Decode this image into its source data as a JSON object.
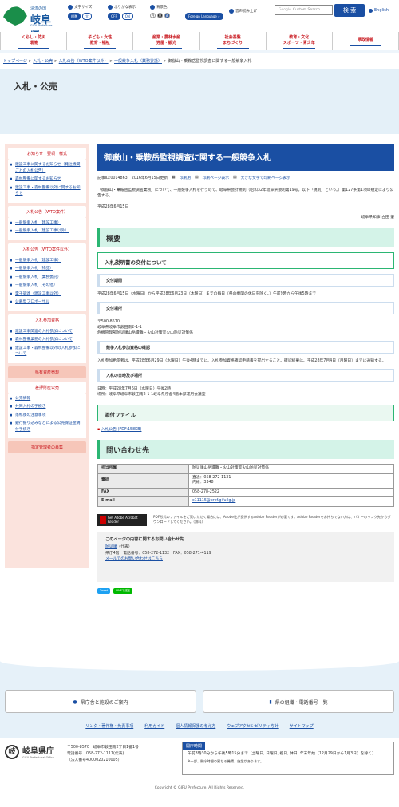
{
  "header": {
    "logo_tagline": "清流の国",
    "logo_name": "岐阜県",
    "logo_en": "GIFU Prefecture",
    "font_size_label": "文字サイズ",
    "font_standard": "標準",
    "font_large": "大",
    "ruby_label": "ふりがな表示",
    "ruby_off": "OFF",
    "ruby_on": "ON",
    "bg_label": "背景色",
    "bg_white": "白",
    "bg_black": "黒",
    "bg_blue": "青",
    "foreign_language": "Foreign Language »",
    "read_aloud": "音声読み上げ",
    "search_placeholder": "Custom Search",
    "search_brand": "Google",
    "search_button": "検 索",
    "english_link": "English"
  },
  "gnav": [
    {
      "l1": "くらし・防災",
      "l2": "環境"
    },
    {
      "l1": "子ども・女性",
      "l2": "教育・福祉"
    },
    {
      "l1": "産業・農林水産",
      "l2": "労働・観光"
    },
    {
      "l1": "社会基盤",
      "l2": "まちづくり"
    },
    {
      "l1": "教育・文化",
      "l2": "スポーツ・青少年"
    },
    {
      "l1": "県政情報",
      "l2": ""
    }
  ],
  "breadcrumb": [
    "トップページ",
    "入札・公売",
    "入札公告（WTO案件以外）",
    "一般競争入札（業務委託）",
    "御嶽山・乗鞍岳監視調査に関する一般競争入札"
  ],
  "page_title": "入札・公売",
  "sidebar": {
    "h1": "お知らせ・要領・様式",
    "g1": [
      "建設工事に関するお知らせ（発注機関ごとの入札公告）",
      "森林整備に関するお知らせ",
      "建設工事・森林整備以外に関するお知らせ"
    ],
    "h2": "入札公告（WTO案件）",
    "g2": [
      "一般競争入札（建設工事）",
      "一般競争入札（建設工事以外）"
    ],
    "h3": "入札公告（WTO案件以外）",
    "g3": [
      "一般競争入札（建設工事）",
      "一般競争入札（物品）",
      "一般競争入札（業務委託）",
      "一般競争入札（その他）",
      "電子調達（建設工事以外）",
      "公募型プロポーザル"
    ],
    "h4": "入札参加資格",
    "g4": [
      "建設工事関連の入札参加について",
      "森林整備業務の入札参加について",
      "建設工事・森林整備以外の入札参加について"
    ],
    "h5": "県有資産売却",
    "h6": "差押財産公売",
    "g6": [
      "公売情報",
      "共同入札の手続き",
      "落札後の注意事項",
      "銀行振り込みなどによる公売保証金納付手続き"
    ],
    "h7": "指定管理者の募集"
  },
  "article": {
    "title": "御嶽山・乗鞍岳監視調査に関する一般競争入札",
    "meta_id": "記事ID:0014863",
    "meta_date": "2016年6月15日更新",
    "meta_print": "印刷用",
    "meta_print_page": "印刷ページ表示",
    "meta_big_print": "大きな文字で印刷ページ表示",
    "intro": "「御嶽山・乗鞍岳監視調査業務」について、一般競争入札を行うので、岐阜県会計規則（昭和32年岐阜県規則第19号。以下「規則」という。）第127条第1項の規定により公告する。",
    "date": "平成28年6月15日",
    "signer": "岐阜県知事 古田 肇",
    "h_overview": "概要",
    "h_docs": "入札説明書の交付について",
    "h_period": "交付期間",
    "period_text": "平成28年6月15日（水曜日）から平成28年6月23日（木曜日）までの毎日（県の機関の休日を除く。）午前9時から午後5時まで",
    "h_place": "交付場所",
    "place_lines": [
      "〒500-8570",
      "岐阜県岐阜市薮田南2-1-1",
      "危機管理部防災課山岳遭難・火山対策室火山防災対策係"
    ],
    "h_confirm": "競争入札参加資格の確認",
    "confirm_text": "入札参加希望者は、平成28年6月29日（水曜日）午後4時までに、入札参加資格確認申請書を提出すること。確認結果は、平成28年7月4日（月曜日）までに通知する。",
    "h_schedule": "入札の日時及び場所",
    "schedule_lines": [
      "日時：平成28年7月6日（水曜日）午後2時",
      "場所：岐阜県岐阜市薮田南2-1-1岐阜県庁舎4階本部運用会議室"
    ],
    "h_files": "添付ファイル",
    "file_link": "入札公告 (PDF:158KB)",
    "h_inquiry": "問い合わせ先",
    "inquiry": [
      {
        "k": "担当所属",
        "v": "防災課山岳遭難・火山対策室火山防災対策係"
      },
      {
        "k": "電話",
        "v": "直通：058-272-1131\n内線：3348"
      },
      {
        "k": "FAX",
        "v": "058-278-2522"
      },
      {
        "k": "E-mail",
        "v": "c11115@pref.gifu.lg.jp"
      }
    ],
    "adobe_badge": "Get Adobe Acrobat Reader",
    "adobe_note": "PDF形式のファイルをご覧いただく場合には、Adobe社が提供するAdobe Readerが必要です。Adobe Readerをお持ちでない方は、バナーのリンク先からダウンロードしてください。（無料）",
    "contact_title": "このページの内容に関するお問い合わせ先",
    "contact_dept": "防災課",
    "contact_dept_suffix": "（代表）",
    "contact_line": "県庁4階　電話番号：058-272-1132　FAX：058-271-4119",
    "contact_mail": "メールでのお問い合わせはこちら",
    "share_tweet": "Tweet",
    "share_line": "LINEで送る"
  },
  "footer": {
    "btn_left": "県庁舎と施設のご案内",
    "btn_right": "県の組織・電話番号一覧",
    "links": [
      "リンク・著作権・免責事項",
      "利用ガイド",
      "個人情報保護の考え方",
      "ウェブアクセシビリティ方針",
      "サイトマップ"
    ],
    "org_name": "岐阜県庁",
    "org_en": "GIFU Prefectural Office",
    "addr1": "〒500-8570　岐阜市薮田南2丁目1番1号",
    "addr2": "電話番号　058-272-1111(代表)",
    "addr3": "（法人番号4000020210005）",
    "hours_title": "開庁時間",
    "hours_text": "午前8時30分から午後5時15分まで（土曜日, 日曜日, 祝日, 休日, 年末年始（12月29日から1月3日）を除く）",
    "hours_note": "※一部、開庁時間の異なる機関、施設があります。",
    "copyright": "Copyright © GIFU Prefecture, All Rights Reserved."
  }
}
